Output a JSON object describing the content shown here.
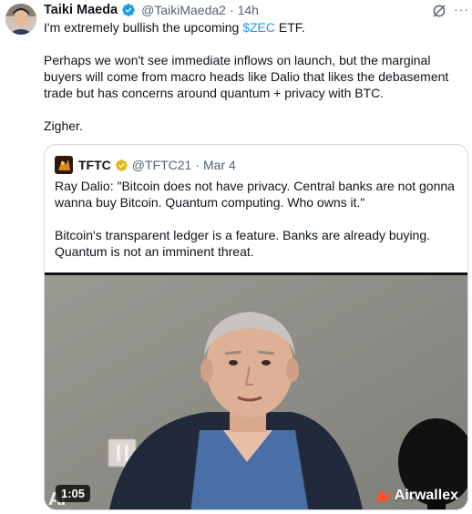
{
  "tweet": {
    "author_name": "Taiki Maeda",
    "handle": "@TaikiMaeda2",
    "separator": "·",
    "time": "14h",
    "text": {
      "line1_before": "I'm extremely bullish the upcoming ",
      "cashtag": "$ZEC",
      "line1_after": " ETF.",
      "para2": "Perhaps we won't see immediate inflows on launch, but the marginal buyers will come from macro heads like Dalio that likes the debasement trade but has concerns around quantum + privacy with BTC.",
      "para3": "Zigher."
    }
  },
  "quoted_tweet": {
    "author_name": "TFTC",
    "handle": "@TFTC21",
    "separator": "·",
    "time": "Mar 4",
    "para1": "Ray Dalio: \"Bitcoin does not have privacy. Central banks are not gonna wanna buy Bitcoin. Quantum computing. Who owns it.\"",
    "para2": "Bitcoin's transparent ledger is a feature. Banks are already buying. Quantum is not an imminent threat.",
    "video": {
      "duration": "1:05",
      "brand": "Airwallex",
      "watermark": "AI"
    }
  },
  "icons": {
    "verified": "verified-blue-check-icon",
    "grok": "grok-icon",
    "more": "more-options-icon",
    "gold_badge": "verified-gold-badge-icon"
  },
  "colors": {
    "accent": "#1d9bf0",
    "text": "#0f1419",
    "secondary": "#536471",
    "border": "#cfd9de",
    "gold": "#e2b719",
    "brand_orange": "#ff4f28"
  }
}
